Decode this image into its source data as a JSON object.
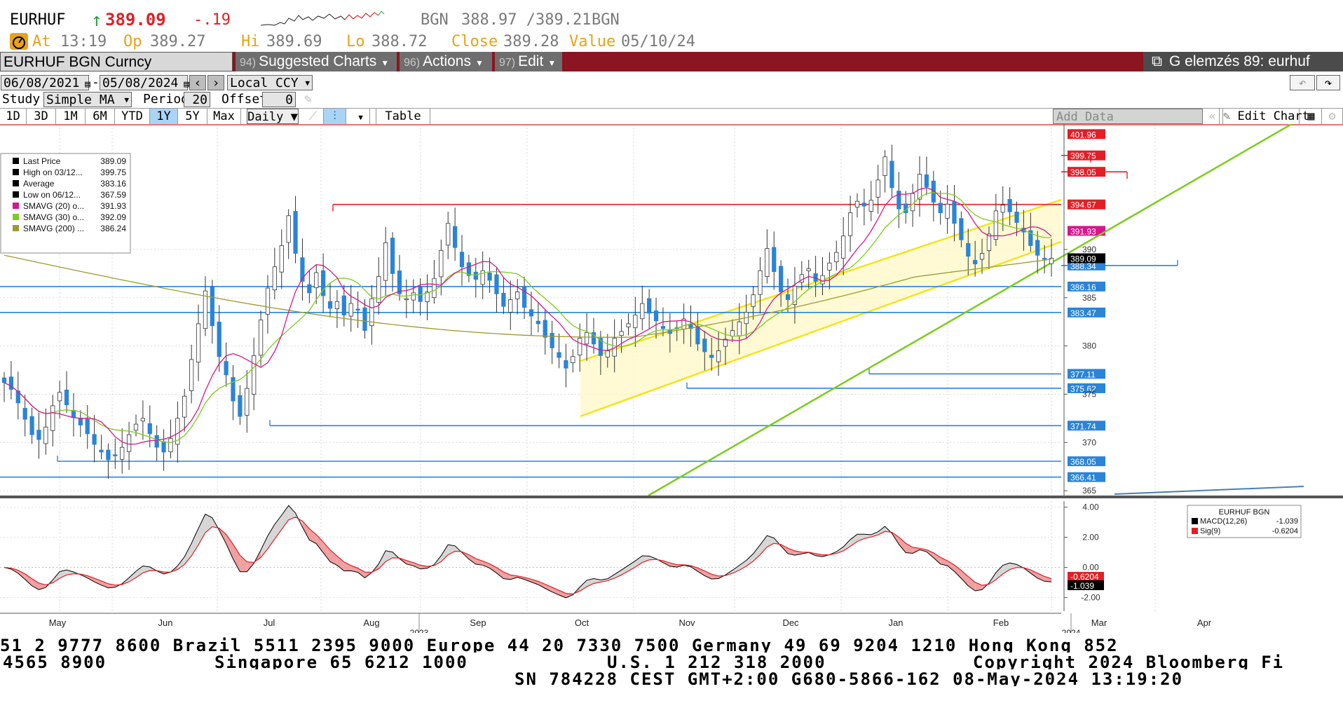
{
  "quote": {
    "ticker": "EURHUF",
    "arrow": "↑",
    "last": "389.09",
    "change": "-.19",
    "source": "BGN",
    "bid_ask": "388.97 /389.21",
    "source2": "BGN",
    "at_label": "At",
    "at_time": "13:19",
    "op_label": "Op",
    "op": "389.27",
    "hi_label": "Hi",
    "hi": "389.69",
    "lo_label": "Lo",
    "lo": "388.72",
    "close_label": "Close",
    "close": "389.28",
    "value_label": "Value",
    "value_date": "05/10/24"
  },
  "toolbar": {
    "security": "EURHUF BGN Curncy",
    "suggested_num": "94)",
    "suggested": "Suggested Charts",
    "actions_num": "96)",
    "actions": "Actions",
    "edit_num": "97)",
    "edit": "Edit",
    "analysis": "G elemzés 89: eurhuf"
  },
  "range": {
    "start": "06/08/2021",
    "dash": "-",
    "end": "05/08/2024",
    "currency": "Local CCY"
  },
  "study": {
    "label": "Study",
    "type": "Simple MA",
    "period_label": "Period",
    "period": "20",
    "offset_label": "Offset",
    "offset": "0"
  },
  "periods": [
    "1D",
    "3D",
    "1M",
    "6M",
    "YTD",
    "1Y",
    "5Y",
    "Max"
  ],
  "active_period": "1Y",
  "frequency": "Daily ▼",
  "table_label": "Table",
  "add_data": "Add Data",
  "edit_chart": "Edit Chart",
  "legend": [
    {
      "label": "Last Price",
      "value": "389.09",
      "color": "#000000"
    },
    {
      "label": "High on 03/12...",
      "value": "399.75",
      "color": "#000000"
    },
    {
      "label": "Average",
      "value": "383.16",
      "color": "#000000"
    },
    {
      "label": "Low on 06/12...",
      "value": "367.59",
      "color": "#000000"
    },
    {
      "label": "SMAVG (20)   o...",
      "value": "391.93",
      "color": "#d6168c"
    },
    {
      "label": "SMAVG (30)   o...",
      "value": "392.09",
      "color": "#7ccc1e"
    },
    {
      "label": "SMAVG (200)  ...",
      "value": "386.24",
      "color": "#9e9a2e"
    }
  ],
  "chart_data": [
    {
      "type": "candlestick",
      "title": "",
      "y_ticks": [
        "390",
        "385",
        "380",
        "375",
        "370",
        "365"
      ],
      "ylim": [
        364.5,
        403
      ],
      "x_ticks": [
        "May",
        "Jun",
        "Jul",
        "Aug",
        "Sep",
        "Oct",
        "Nov",
        "Dec",
        "Jan",
        "Feb",
        "Mar",
        "Apr"
      ],
      "x_year_labels": [
        {
          "label": "2023",
          "month": "Aug"
        },
        {
          "label": "2024",
          "month": "Feb"
        }
      ],
      "horizontal_levels": [
        {
          "value": "401.96",
          "color": "#e21f26"
        },
        {
          "value": "399.75",
          "color": "#e21f26"
        },
        {
          "value": "398.05",
          "color": "#e21f26"
        },
        {
          "value": "394.67",
          "color": "#e21f26"
        },
        {
          "value": "391.93",
          "color": "#d6168c"
        },
        {
          "value": "388.34",
          "color": "#2a84d8"
        },
        {
          "value": "386.16",
          "color": "#2a84d8"
        },
        {
          "value": "383.47",
          "color": "#2a84d8"
        },
        {
          "value": "377.11",
          "color": "#2a84d8"
        },
        {
          "value": "375.62",
          "color": "#2a84d8"
        },
        {
          "value": "371.74",
          "color": "#2a84d8"
        },
        {
          "value": "368.05",
          "color": "#2a84d8"
        },
        {
          "value": "366.41",
          "color": "#2a84d8"
        }
      ],
      "last_label": "389.09",
      "close": [
        376.2,
        375.5,
        374.1,
        372.4,
        370.8,
        370.3,
        371.6,
        373.8,
        375.2,
        373.9,
        372.6,
        371.8,
        370.9,
        369.8,
        369.0,
        368.2,
        368.6,
        369.5,
        370.8,
        371.9,
        372.5,
        370.9,
        369.5,
        369.0,
        370.4,
        372.5,
        374.8,
        378.6,
        382.3,
        385.7,
        382.1,
        378.9,
        377.0,
        374.3,
        372.7,
        375.6,
        379.0,
        382.7,
        386.0,
        388.2,
        390.4,
        393.5,
        389.6,
        386.7,
        385.5,
        387.6,
        385.2,
        383.9,
        384.6,
        383.2,
        384.4,
        383.7,
        381.6,
        384.9,
        387.2,
        390.7,
        387.5,
        385.4,
        384.9,
        385.5,
        384.6,
        385.6,
        387.0,
        389.9,
        392.7,
        390.2,
        388.2,
        387.3,
        386.9,
        387.8,
        386.8,
        385.4,
        384.1,
        384.8,
        385.6,
        384.0,
        383.1,
        382.3,
        380.9,
        379.8,
        378.8,
        377.7,
        378.9,
        380.8,
        381.4,
        380.2,
        379.0,
        379.5,
        380.8,
        381.5,
        382.3,
        383.2,
        384.4,
        383.4,
        382.6,
        381.8,
        381.3,
        381.8,
        382.8,
        381.8,
        380.2,
        379.4,
        378.8,
        379.5,
        380.7,
        381.6,
        382.5,
        383.5,
        385.3,
        387.8,
        390.1,
        387.7,
        385.6,
        384.8,
        386.2,
        387.4,
        388.0,
        386.7,
        387.3,
        388.6,
        389.7,
        391.4,
        393.8,
        395.0,
        394.5,
        395.1,
        397.2,
        399.6,
        396.4,
        394.2,
        393.8,
        395.8,
        397.8,
        396.5,
        394.9,
        393.8,
        394.7,
        392.7,
        391.0,
        389.3,
        388.5,
        389.6,
        391.6,
        394.0,
        394.6,
        393.9,
        392.8,
        391.8,
        390.4,
        389.4,
        389.0,
        389.1
      ],
      "series": [
        {
          "name": "SMAVG (20)",
          "color": "#d6168c",
          "value": "391.93"
        },
        {
          "name": "SMAVG (30)",
          "color": "#7ccc1e",
          "value": "392.09"
        },
        {
          "name": "SMAVG (200)",
          "color": "#9e9a2e",
          "value": "386.24"
        }
      ]
    },
    {
      "type": "line",
      "title": "EURHUF BGN",
      "y_ticks": [
        "4.00",
        "2.00",
        "0.00",
        "-2.00"
      ],
      "ylim": [
        -2.9,
        4.4
      ],
      "series": [
        {
          "name": "MACD(12,26)",
          "value": "-1.039",
          "color": "#000000"
        },
        {
          "name": "Sig(9)",
          "value": "-0.6204",
          "color": "#e21f26"
        }
      ],
      "last_labels": [
        "-0.6204",
        "-1.039"
      ]
    }
  ],
  "footer": {
    "line1": "51 2 9777 8600 Brazil 5511 2395 9000 Europe 44 20 7330 7500 Germany 49 69 9204 1210 Hong Kong 852",
    "line2_a": "4565 8900",
    "line2_b": "Singapore 65 6212 1000",
    "line2_c": "U.S. 1 212 318 2000",
    "line2_d": "Copyright 2024 Bloomberg Fi",
    "line3": "SN 784228 CEST GMT+2:00 G680-5866-162 08-May-2024 13:19:20"
  }
}
